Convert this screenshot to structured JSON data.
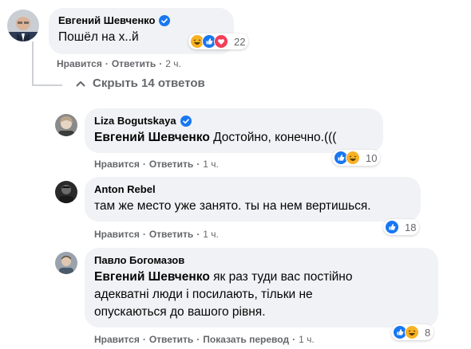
{
  "comments": [
    {
      "author": "Евгений Шевченко",
      "verified": true,
      "mention": "",
      "text": "Пошёл на х..й",
      "like_label": "Нравится",
      "reply_label": "Ответить",
      "time": "2 ч.",
      "reaction_icons": [
        "haha-icon",
        "like-icon",
        "love-icon"
      ],
      "reaction_count": "22"
    },
    {
      "author": "Liza Bogutskaya",
      "verified": true,
      "mention": "Евгений Шевченко",
      "text": "Достойно, конечно.(((",
      "like_label": "Нравится",
      "reply_label": "Ответить",
      "time": "1 ч.",
      "reaction_icons": [
        "like-icon",
        "haha-icon"
      ],
      "reaction_count": "10"
    },
    {
      "author": "Anton Rebel",
      "verified": false,
      "mention": "",
      "text": "там же место уже занято. ты на нем вертишься.",
      "like_label": "Нравится",
      "reply_label": "Ответить",
      "time": "1 ч.",
      "reaction_icons": [
        "like-icon"
      ],
      "reaction_count": "18"
    },
    {
      "author": "Павло Богомазов",
      "verified": false,
      "mention": "Евгений Шевченко",
      "text": "як раз туди вас постійно адекватні люди і посилають, тільки не опускаються до вашого рівня.",
      "like_label": "Нравится",
      "reply_label": "Ответить",
      "translate_label": "Показать перевод",
      "time": "1 ч.",
      "reaction_icons": [
        "like-icon",
        "haha-icon"
      ],
      "reaction_count": "8"
    }
  ],
  "hide_replies_label": "Скрыть 14 ответов",
  "colors": {
    "like": "#1877f2",
    "love": "#f33e58",
    "haha": "#f7b125",
    "bubble": "#f0f2f5",
    "secondary_text": "#65676b"
  }
}
